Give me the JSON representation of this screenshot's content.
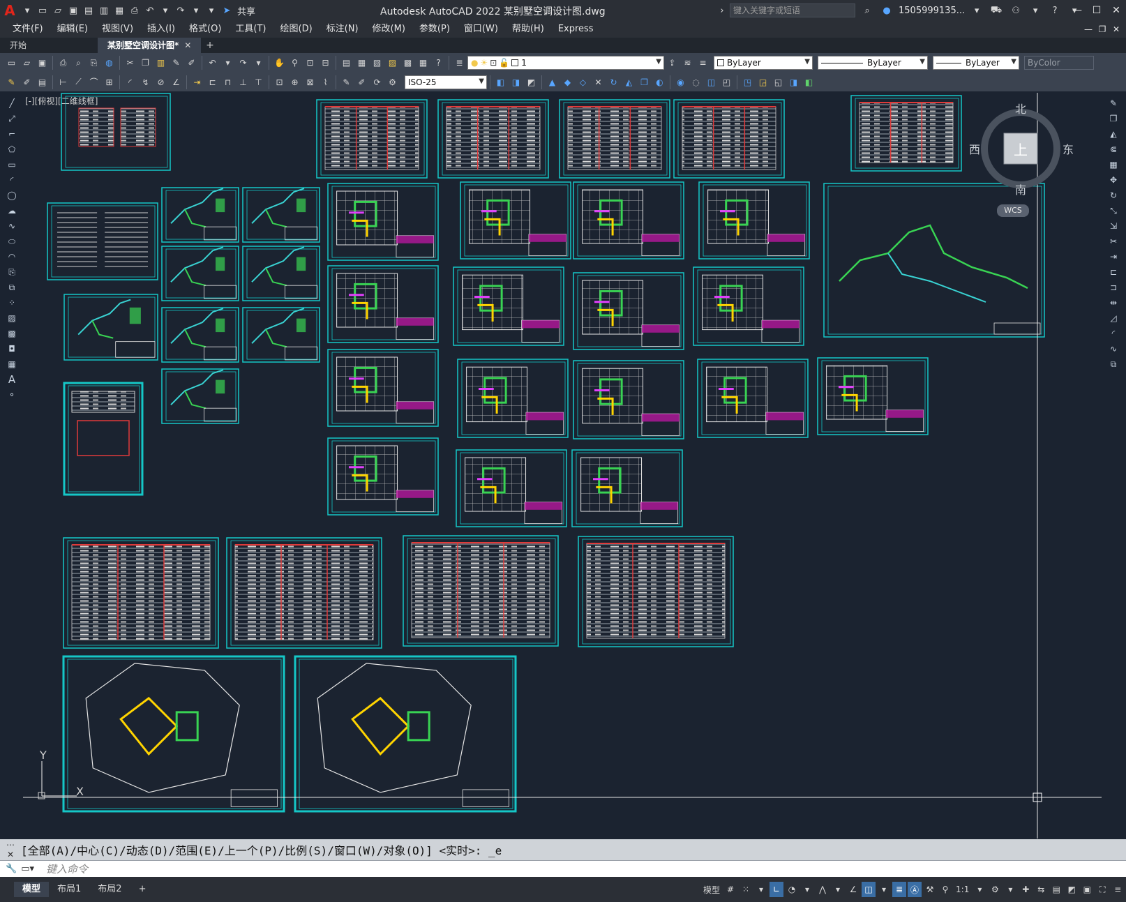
{
  "app": {
    "logo": "A",
    "title": "Autodesk AutoCAD 2022    某别墅空调设计图.dwg",
    "share_label": "共享",
    "search_placeholder": "键入关键字或短语",
    "user_name": "1505999135..."
  },
  "menu": {
    "items": [
      "文件(F)",
      "编辑(E)",
      "视图(V)",
      "插入(I)",
      "格式(O)",
      "工具(T)",
      "绘图(D)",
      "标注(N)",
      "修改(M)",
      "参数(P)",
      "窗口(W)",
      "帮助(H)",
      "Express"
    ]
  },
  "tabs": {
    "start_label": "开始",
    "active_label": "某别墅空调设计图*",
    "close_glyph": "✕",
    "add_glyph": "+"
  },
  "toolbar": {
    "layer_value": "1",
    "dim_style_value": "ISO-25",
    "color_value": "ByLayer",
    "linetype_value": "ByLayer",
    "lineweight_value": "ByLayer",
    "plotstyle_value": "ByColor"
  },
  "viewport": {
    "label": "[-][俯视][二维线框]"
  },
  "viewcube": {
    "north": "北",
    "south": "南",
    "east": "东",
    "west": "西",
    "top": "上",
    "wcs": "WCS"
  },
  "ucs": {
    "x_label": "X",
    "y_label": "Y"
  },
  "command": {
    "history": "[全部(A)/中心(C)/动态(D)/范围(E)/上一个(P)/比例(S)/窗口(W)/对象(O)] <实时>: _e",
    "placeholder": "键入命令"
  },
  "status": {
    "layout_tabs": [
      "模型",
      "布局1",
      "布局2"
    ],
    "add_layout": "+",
    "model_label": "模型",
    "scale_label": "1:1"
  },
  "colors": {
    "accent_cyan": "#15c7c7",
    "canvas_bg": "#1b2330",
    "chrome_bg": "#2b2f36",
    "toolbar_bg": "#3b4350",
    "logo_red": "#e1251b"
  }
}
